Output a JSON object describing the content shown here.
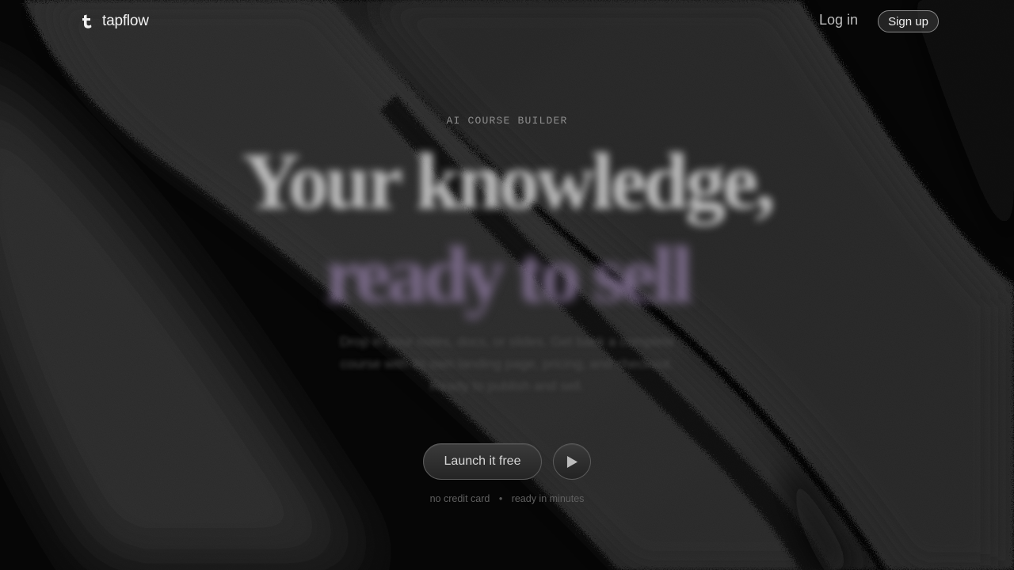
{
  "header": {
    "brand_name": "tapflow",
    "login_label": "Log in",
    "signup_label": "Sign up"
  },
  "hero": {
    "eyebrow": "AI COURSE BUILDER",
    "headline_line1": "Your knowledge,",
    "headline_line2": "ready to sell",
    "subcopy": "Drop in your notes, docs, or slides. Get back a complete course with its own landing page, pricing, and checkout. Ready to publish and sell.",
    "cta_label": "Launch it free",
    "footnote_left": "no credit card",
    "footnote_separator": "•",
    "footnote_right": "ready in minutes"
  },
  "icons": {
    "logo": "tapflow-logo-icon",
    "play": "play-icon"
  },
  "colors": {
    "background": "#060606",
    "headline": "#bdbdbd",
    "headline_accent": "#7b6b8a",
    "button_bg": "#2e2e2e"
  }
}
